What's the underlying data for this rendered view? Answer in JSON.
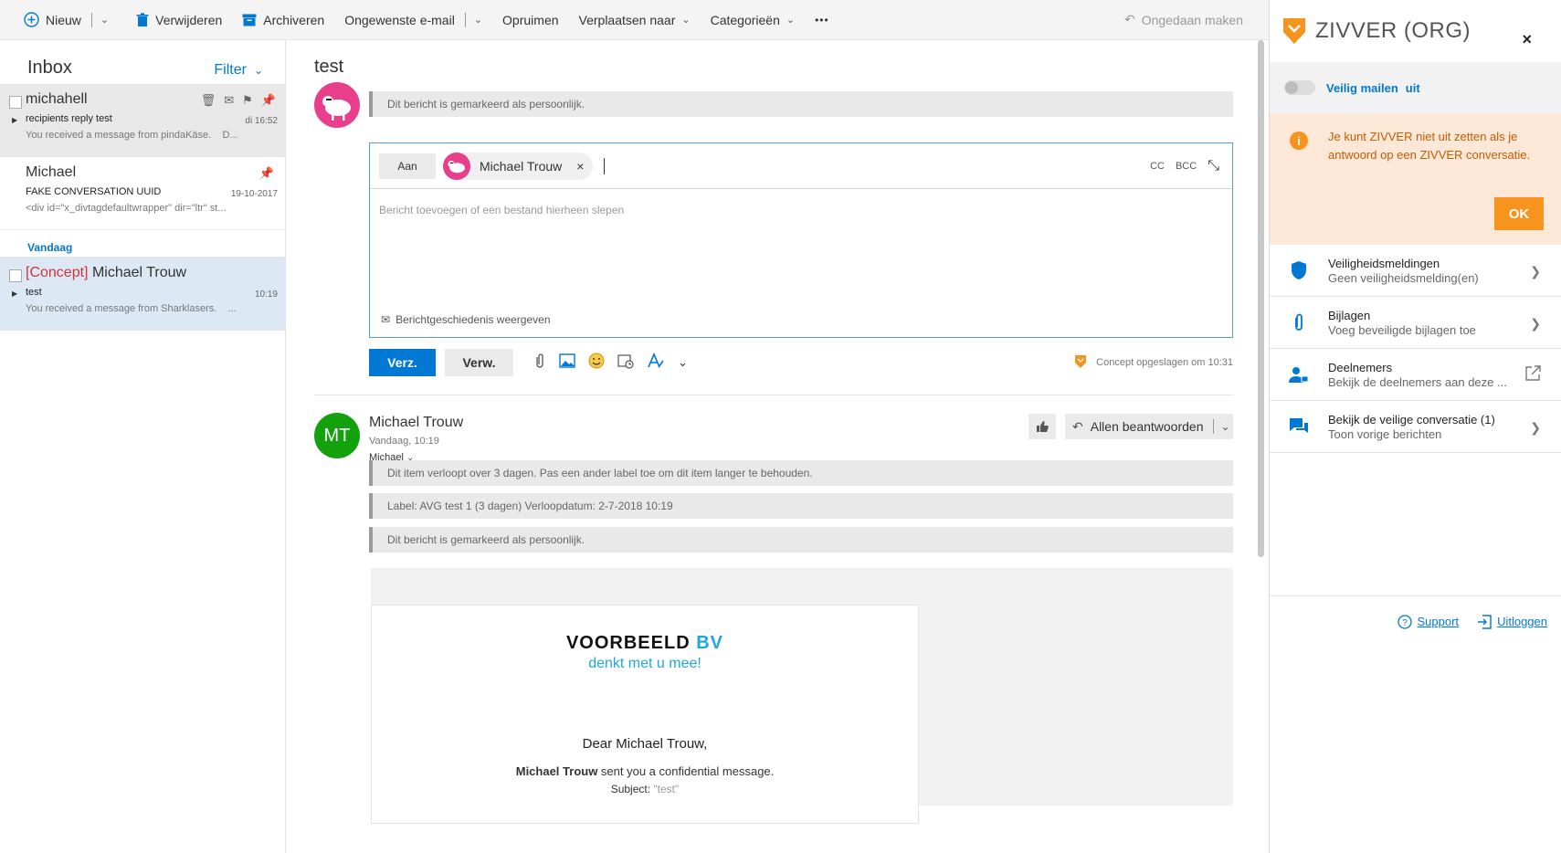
{
  "toolbar": {
    "new_label": "Nieuw",
    "delete_label": "Verwijderen",
    "archive_label": "Archiveren",
    "junk_label": "Ongewenste e-mail",
    "sweep_label": "Opruimen",
    "move_label": "Verplaatsen naar",
    "categories_label": "Categorieën",
    "more_label": "•••",
    "undo_label": "Ongedaan maken"
  },
  "inbox": {
    "title": "Inbox",
    "filter_label": "Filter",
    "group_today": "Vandaag",
    "messages": [
      {
        "sender": "michahell",
        "subject": "recipients reply test",
        "preview": "You received a message from pindaKäse.",
        "preview_more": "D...",
        "time": "di 16:52"
      },
      {
        "sender": "Michael",
        "subject": "FAKE CONVERSATION UUID",
        "preview": "<div id=\"x_divtagdefaultwrapper\" dir=\"ltr\" st...",
        "time": "19-10-2017"
      },
      {
        "concept_tag": "[Concept]",
        "sender": "Michael Trouw",
        "subject": "test",
        "preview": "You received a message from Sharklasers.",
        "preview_more": "...",
        "time": "10:19"
      }
    ]
  },
  "reading": {
    "subject": "test",
    "personal_notice": "Dit bericht is gemarkeerd als persoonlijk.",
    "compose": {
      "to_label": "Aan",
      "recipient": "Michael Trouw",
      "remove_icon": "×",
      "cc_label": "CC",
      "bcc_label": "BCC",
      "placeholder": "Bericht toevoegen of een bestand hierheen slepen",
      "history_label": "Berichtgeschiedenis weergeven",
      "send_label": "Verz.",
      "discard_label": "Verw.",
      "saved_label": "Concept opgeslagen om 10:31"
    },
    "message": {
      "avatar_initials": "MT",
      "from": "Michael Trouw",
      "date": "Vandaag, 10:19",
      "to": "Michael",
      "reply_all_label": "Allen beantwoorden",
      "notices": [
        "Dit item verloopt over 3 dagen. Pas een ander label toe om dit item langer te behouden.",
        "Label: AVG test 1 (3 dagen) Verloopdatum: 2-7-2018 10:19",
        "Dit bericht is gemarkeerd als persoonlijk."
      ],
      "body": {
        "brand_main": "VOORBEELD",
        "brand_accent": "BV",
        "tagline": "denkt met u mee!",
        "greeting": "Dear Michael Trouw,",
        "sender_bold": "Michael Trouw",
        "sent_text": " sent you a confidential message.",
        "subject_label": "Subject: ",
        "subject_value": "\"test\""
      }
    }
  },
  "zivver": {
    "title": "ZIVVER (ORG)",
    "close_icon": "×",
    "toggle_label": "Veilig mailen",
    "toggle_state": "uit",
    "warning_icon": "i",
    "warning_text": "Je kunt ZIVVER niet uit zetten als je antwoord op een ZIVVER conversatie.",
    "ok_label": "OK",
    "items": [
      {
        "title": "Veiligheidsmeldingen",
        "subtitle": "Geen veiligheidsmelding(en)",
        "icon": "shield-icon"
      },
      {
        "title": "Bijlagen",
        "subtitle": "Voeg beveiligde bijlagen toe",
        "icon": "paperclip-icon"
      },
      {
        "title": "Deelnemers",
        "subtitle": "Bekijk de deelnemers aan deze ...",
        "icon": "people-lock-icon"
      },
      {
        "title": "Bekijk de veilige conversatie (1)",
        "subtitle": "Toon vorige berichten",
        "icon": "chat-icon"
      }
    ],
    "support_label": "Support",
    "logout_label": "Uitloggen"
  },
  "colors": {
    "accent": "#0078d4",
    "zivver_orange": "#f7941d",
    "concept_red": "#d13438",
    "avatar_green": "#13a10e",
    "avatar_pink": "#e83e8c"
  }
}
